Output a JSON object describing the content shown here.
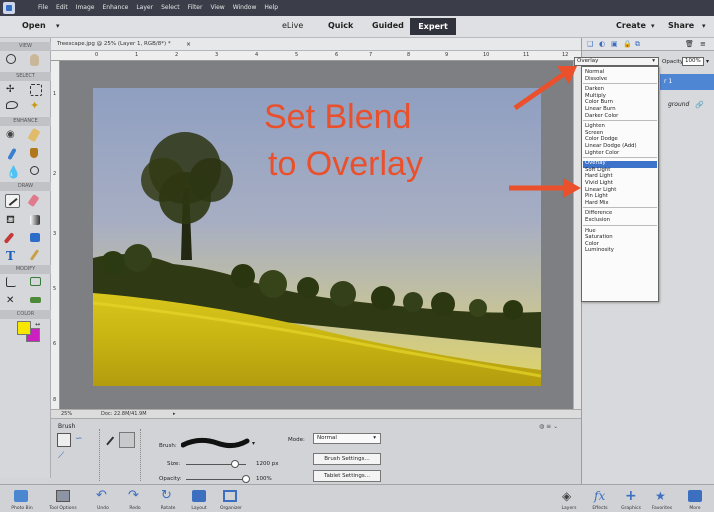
{
  "menubar": {
    "items": [
      "File",
      "Edit",
      "Image",
      "Enhance",
      "Layer",
      "Select",
      "Filter",
      "View",
      "Window",
      "Help"
    ]
  },
  "modebar": {
    "open": "Open",
    "elive": "eLive",
    "quick": "Quick",
    "guided": "Guided",
    "expert": "Expert",
    "create": "Create",
    "share": "Share"
  },
  "doc": {
    "tab_title": "Treescape.jpg @ 25% (Layer 1, RGB/8*) *",
    "zoom": "25%",
    "doc_size": "Doc: 22.8M/41.9M"
  },
  "ruler": {
    "h": [
      "0",
      "1",
      "2",
      "3",
      "4",
      "5",
      "6",
      "7",
      "8",
      "9",
      "10",
      "11",
      "12"
    ],
    "v": [
      "1",
      "2",
      "3",
      "4",
      "5",
      "6",
      "7",
      "8"
    ]
  },
  "toolbox": {
    "view": "VIEW",
    "select": "SELECT",
    "enhance": "ENHANCE",
    "draw": "DRAW",
    "modify": "MODIFY",
    "color": "COLOR"
  },
  "annotation": {
    "line1": "Set Blend",
    "line2": "to Overlay"
  },
  "layers": {
    "blend_value": "Overlay",
    "opacity_label": "Opacity:",
    "opacity_value": "100%",
    "layer_name": "r 1",
    "bg_name": "ground"
  },
  "blend_groups": [
    [
      "Normal",
      "Dissolve"
    ],
    [
      "Darken",
      "Multiply",
      "Color Burn",
      "Linear Burn",
      "Darker Color"
    ],
    [
      "Lighten",
      "Screen",
      "Color Dodge",
      "Linear Dodge (Add)",
      "Lighter Color"
    ],
    [
      "Overlay",
      "Soft Light",
      "Hard Light",
      "Vivid Light",
      "Linear Light",
      "Pin Light",
      "Hard Mix"
    ],
    [
      "Difference",
      "Exclusion"
    ],
    [
      "Hue",
      "Saturation",
      "Color",
      "Luminosity"
    ]
  ],
  "tool_options": {
    "title": "Brush",
    "brush_label": "Brush:",
    "mode_label": "Mode:",
    "mode_value": "Normal",
    "size_label": "Size:",
    "size_value": "1200 px",
    "opacity_label": "Opacity:",
    "opacity_value": "100%",
    "brush_settings": "Brush Settings...",
    "tablet_settings": "Tablet Settings...",
    "size_fraction": 0.82,
    "opacity_fraction": 1.0
  },
  "bottombar": {
    "left": [
      "Photo Bin",
      "Tool Options",
      "Undo",
      "Redo",
      "Rotate",
      "Layout",
      "Organizer"
    ],
    "right": [
      "Layers",
      "Effects",
      "Graphics",
      "Favorites",
      "More"
    ]
  },
  "colors": {
    "accent": "#e9502b",
    "highlight": "#3d73c9",
    "foreground": "#f7e600",
    "background": "#cc1fbf"
  }
}
